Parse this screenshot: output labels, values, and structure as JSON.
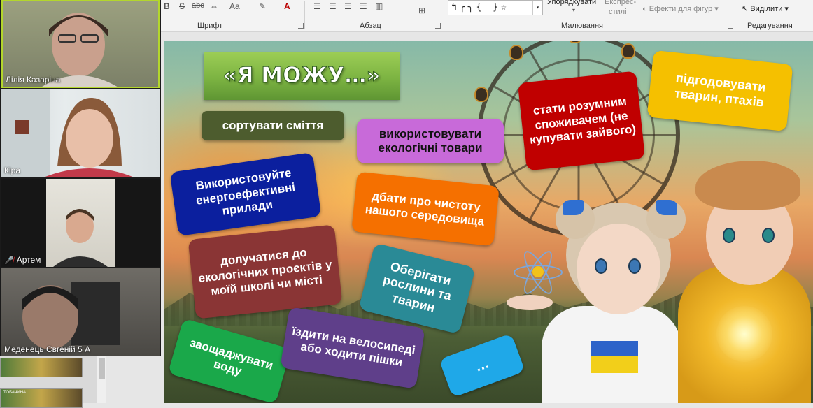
{
  "ribbon": {
    "groups": {
      "font": "Шрифт",
      "paragraph": "Абзац",
      "drawing": "Малювання",
      "editing": "Редагування"
    },
    "buttons": {
      "arrange": "Упорядкувати",
      "quick_styles_1": "Експрес-",
      "quick_styles_2": "стилі",
      "shape_effects": "Ефекти для фігур",
      "select": "Виділити",
      "font_size": "Aa",
      "strike": "abc",
      "shadow": "S"
    },
    "shape_gallery": "↰╭╮{ }☆"
  },
  "participants": [
    {
      "name": "Лілія Казаріна",
      "active_speaker": true
    },
    {
      "name": "Кіра",
      "active_speaker": false
    },
    {
      "name": "Артем",
      "muted": true
    },
    {
      "name": "Меденець Євгеній 5 А",
      "active_speaker": false
    }
  ],
  "thumbnails": [
    "",
    "ТОБАЧИНА"
  ],
  "slide": {
    "title": "«Я МОЖУ…»",
    "cards": [
      {
        "id": "sort-waste",
        "text": "сортувати сміття",
        "color": "#4d5c2e"
      },
      {
        "id": "eco-goods",
        "text": "використовувати екологічні товари",
        "color": "#c86ad9"
      },
      {
        "id": "smart-consumer",
        "text": "стати розумним споживачем (не купувати зайвого)",
        "color": "#c00000"
      },
      {
        "id": "feed-animals",
        "text": "підгодовувати тварин,  птахів",
        "color": "#f5c000"
      },
      {
        "id": "energy-devices",
        "text": "Використовуйте енергоефективні прилади",
        "color": "#0b1f9e"
      },
      {
        "id": "clean-environment",
        "text": "дбати про чистоту нашого середовища",
        "color": "#f57000"
      },
      {
        "id": "eco-projects",
        "text": "долучатися до екологічних проєктів у моїй школі чи місті",
        "color": "#8a3535"
      },
      {
        "id": "protect-plants",
        "text": "Оберігати рослини та тварин",
        "color": "#2a8a96"
      },
      {
        "id": "save-water",
        "text": "заощаджувати воду",
        "color": "#1aa84a"
      },
      {
        "id": "bike-walk",
        "text": "їздити на велосипеді або ходити пішки",
        "color": "#5f3f8a"
      },
      {
        "id": "etc",
        "text": "…",
        "color": "#1fa8e8"
      }
    ]
  }
}
